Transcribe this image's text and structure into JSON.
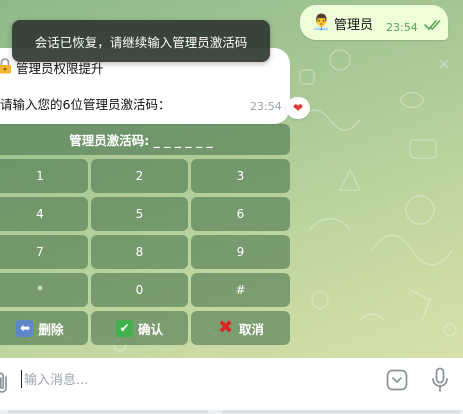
{
  "toast": {
    "text": "会话已恢复，请继续输入管理员激活码"
  },
  "outgoing_message": {
    "emoji": "👨‍💼",
    "text": "管理员",
    "time": "23:54",
    "status": "read"
  },
  "incoming_message": {
    "title_icon": "lock-with-key-icon",
    "title": "管理员权限提升",
    "prompt": "请输入您的6位管理员激活码：",
    "time": "23:54",
    "reaction": "❤"
  },
  "keyboard": {
    "header": "管理员激活码: _ _ _ _ _ _",
    "keys": [
      [
        "1",
        "2",
        "3"
      ],
      [
        "4",
        "5",
        "6"
      ],
      [
        "7",
        "8",
        "9"
      ],
      [
        "*",
        "0",
        "#"
      ]
    ],
    "actions": [
      {
        "icon": "back-arrow-icon",
        "glyph": "⬅",
        "label": "删除"
      },
      {
        "icon": "check-mark-icon",
        "glyph": "✔",
        "label": "确认"
      },
      {
        "icon": "cross-mark-icon",
        "glyph": "✖",
        "label": "取消"
      }
    ]
  },
  "input_bar": {
    "placeholder": "输入消息..."
  },
  "colors": {
    "chat_bg": "#a7c794",
    "outgoing_bubble": "#eefed8",
    "keyboard_button": "#4e7850",
    "toast_bg": "#303832"
  }
}
